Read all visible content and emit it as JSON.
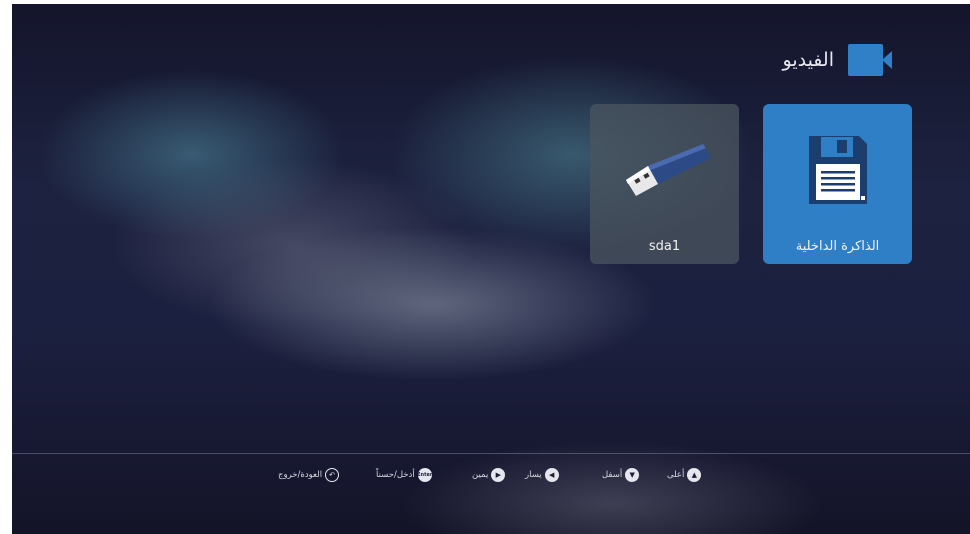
{
  "header": {
    "title": "الفيديو",
    "icon": "video-camera-icon"
  },
  "sources": [
    {
      "label": "الذاكرة الداخلية",
      "icon": "floppy-disk-icon",
      "selected": true
    },
    {
      "label": "sda1",
      "icon": "usb-drive-icon",
      "selected": false
    }
  ],
  "footer": {
    "hints": [
      {
        "label": "أعلى",
        "icon": "up-arrow-icon"
      },
      {
        "label": "أسفل",
        "icon": "down-arrow-icon"
      },
      {
        "label": "يسار",
        "icon": "left-arrow-icon"
      },
      {
        "label": "يمين",
        "icon": "right-arrow-icon"
      },
      {
        "label": "أدخل/حسناً",
        "icon": "enter-button-icon",
        "icon_text": "Enter"
      },
      {
        "label": "العودة/خروج",
        "icon": "back-return-icon"
      }
    ]
  },
  "colors": {
    "accent": "#2f80c7",
    "tile_dark": "#4b555f",
    "text": "#e8e8f0"
  }
}
